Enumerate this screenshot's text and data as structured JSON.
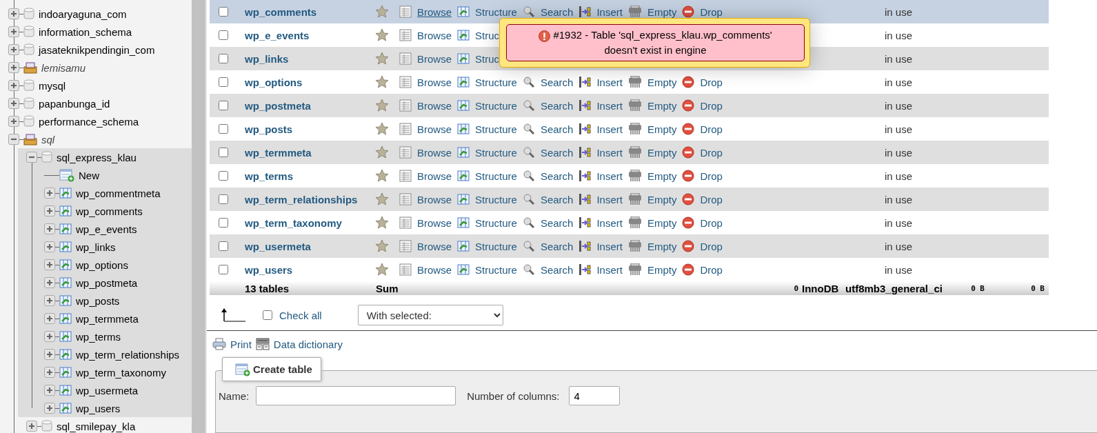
{
  "sidebar": {
    "tree": [
      {
        "name": "indoaryaguna_com",
        "kind": "db",
        "expanded": false,
        "selected": false
      },
      {
        "name": "information_schema",
        "kind": "db",
        "expanded": false,
        "selected": false
      },
      {
        "name": "jasateknikpendingin_com",
        "kind": "db",
        "expanded": false,
        "selected": false
      },
      {
        "name": "lemisamu",
        "kind": "group",
        "expanded": false,
        "selected": false
      },
      {
        "name": "mysql",
        "kind": "db",
        "expanded": false,
        "selected": false
      },
      {
        "name": "papanbunga_id",
        "kind": "db",
        "expanded": false,
        "selected": false
      },
      {
        "name": "performance_schema",
        "kind": "db",
        "expanded": false,
        "selected": false
      },
      {
        "name": "sql",
        "kind": "group",
        "expanded": true,
        "selected": false,
        "children": [
          {
            "name": "sql_express_klau",
            "kind": "db",
            "expanded": true,
            "selected": true,
            "children": [
              {
                "name": "New",
                "kind": "new"
              },
              {
                "name": "wp_commentmeta",
                "kind": "table",
                "expanded": false
              },
              {
                "name": "wp_comments",
                "kind": "table",
                "expanded": false
              },
              {
                "name": "wp_e_events",
                "kind": "table",
                "expanded": false
              },
              {
                "name": "wp_links",
                "kind": "table",
                "expanded": false
              },
              {
                "name": "wp_options",
                "kind": "table",
                "expanded": false
              },
              {
                "name": "wp_postmeta",
                "kind": "table",
                "expanded": false
              },
              {
                "name": "wp_posts",
                "kind": "table",
                "expanded": false
              },
              {
                "name": "wp_termmeta",
                "kind": "table",
                "expanded": false
              },
              {
                "name": "wp_terms",
                "kind": "table",
                "expanded": false
              },
              {
                "name": "wp_term_relationships",
                "kind": "table",
                "expanded": false
              },
              {
                "name": "wp_term_taxonomy",
                "kind": "table",
                "expanded": false
              },
              {
                "name": "wp_usermeta",
                "kind": "table",
                "expanded": false
              },
              {
                "name": "wp_users",
                "kind": "table",
                "expanded": false
              }
            ]
          },
          {
            "name": "sql_smilepay_kla",
            "kind": "db",
            "expanded": false,
            "selected": false
          }
        ]
      }
    ]
  },
  "table": {
    "rows": [
      {
        "name": "wp_comments",
        "checked": false,
        "highlighted": true,
        "status": "in use",
        "actions": [
          {
            "kind": "browse",
            "label": "Browse"
          },
          {
            "kind": "structure",
            "label": "Structure"
          },
          {
            "kind": "search",
            "label": "Search"
          },
          {
            "kind": "insert",
            "label": "Insert"
          },
          {
            "kind": "empty",
            "label": "Empty"
          },
          {
            "kind": "drop",
            "label": "Drop"
          }
        ]
      },
      {
        "name": "wp_e_events",
        "checked": false,
        "highlighted": false,
        "status": "in use",
        "actions": [
          {
            "kind": "browse",
            "label": "Browse"
          },
          {
            "kind": "structure",
            "label": "Struc"
          }
        ]
      },
      {
        "name": "wp_links",
        "checked": false,
        "highlighted": false,
        "status": "in use",
        "actions": [
          {
            "kind": "browse",
            "label": "Browse"
          },
          {
            "kind": "structure",
            "label": "Struc"
          }
        ]
      },
      {
        "name": "wp_options",
        "checked": false,
        "highlighted": false,
        "status": "in use",
        "actions": [
          {
            "kind": "browse",
            "label": "Browse"
          },
          {
            "kind": "structure",
            "label": "Structure"
          },
          {
            "kind": "search",
            "label": "Search"
          },
          {
            "kind": "insert",
            "label": "Insert"
          },
          {
            "kind": "empty",
            "label": "Empty"
          },
          {
            "kind": "drop",
            "label": "Drop"
          }
        ]
      },
      {
        "name": "wp_postmeta",
        "checked": false,
        "highlighted": false,
        "status": "in use",
        "actions": [
          {
            "kind": "browse",
            "label": "Browse"
          },
          {
            "kind": "structure",
            "label": "Structure"
          },
          {
            "kind": "search",
            "label": "Search"
          },
          {
            "kind": "insert",
            "label": "Insert"
          },
          {
            "kind": "empty",
            "label": "Empty"
          },
          {
            "kind": "drop",
            "label": "Drop"
          }
        ]
      },
      {
        "name": "wp_posts",
        "checked": false,
        "highlighted": false,
        "status": "in use",
        "actions": [
          {
            "kind": "browse",
            "label": "Browse"
          },
          {
            "kind": "structure",
            "label": "Structure"
          },
          {
            "kind": "search",
            "label": "Search"
          },
          {
            "kind": "insert",
            "label": "Insert"
          },
          {
            "kind": "empty",
            "label": "Empty"
          },
          {
            "kind": "drop",
            "label": "Drop"
          }
        ]
      },
      {
        "name": "wp_termmeta",
        "checked": false,
        "highlighted": false,
        "status": "in use",
        "actions": [
          {
            "kind": "browse",
            "label": "Browse"
          },
          {
            "kind": "structure",
            "label": "Structure"
          },
          {
            "kind": "search",
            "label": "Search"
          },
          {
            "kind": "insert",
            "label": "Insert"
          },
          {
            "kind": "empty",
            "label": "Empty"
          },
          {
            "kind": "drop",
            "label": "Drop"
          }
        ]
      },
      {
        "name": "wp_terms",
        "checked": false,
        "highlighted": false,
        "status": "in use",
        "actions": [
          {
            "kind": "browse",
            "label": "Browse"
          },
          {
            "kind": "structure",
            "label": "Structure"
          },
          {
            "kind": "search",
            "label": "Search"
          },
          {
            "kind": "insert",
            "label": "Insert"
          },
          {
            "kind": "empty",
            "label": "Empty"
          },
          {
            "kind": "drop",
            "label": "Drop"
          }
        ]
      },
      {
        "name": "wp_term_relationships",
        "checked": false,
        "highlighted": false,
        "status": "in use",
        "actions": [
          {
            "kind": "browse",
            "label": "Browse"
          },
          {
            "kind": "structure",
            "label": "Structure"
          },
          {
            "kind": "search",
            "label": "Search"
          },
          {
            "kind": "insert",
            "label": "Insert"
          },
          {
            "kind": "empty",
            "label": "Empty"
          },
          {
            "kind": "drop",
            "label": "Drop"
          }
        ]
      },
      {
        "name": "wp_term_taxonomy",
        "checked": false,
        "highlighted": false,
        "status": "in use",
        "actions": [
          {
            "kind": "browse",
            "label": "Browse"
          },
          {
            "kind": "structure",
            "label": "Structure"
          },
          {
            "kind": "search",
            "label": "Search"
          },
          {
            "kind": "insert",
            "label": "Insert"
          },
          {
            "kind": "empty",
            "label": "Empty"
          },
          {
            "kind": "drop",
            "label": "Drop"
          }
        ]
      },
      {
        "name": "wp_usermeta",
        "checked": false,
        "highlighted": false,
        "status": "in use",
        "actions": [
          {
            "kind": "browse",
            "label": "Browse"
          },
          {
            "kind": "structure",
            "label": "Structure"
          },
          {
            "kind": "search",
            "label": "Search"
          },
          {
            "kind": "insert",
            "label": "Insert"
          },
          {
            "kind": "empty",
            "label": "Empty"
          },
          {
            "kind": "drop",
            "label": "Drop"
          }
        ]
      },
      {
        "name": "wp_users",
        "checked": false,
        "highlighted": false,
        "status": "in use",
        "actions": [
          {
            "kind": "browse",
            "label": "Browse"
          },
          {
            "kind": "structure",
            "label": "Structure"
          },
          {
            "kind": "search",
            "label": "Search"
          },
          {
            "kind": "insert",
            "label": "Insert"
          },
          {
            "kind": "empty",
            "label": "Empty"
          },
          {
            "kind": "drop",
            "label": "Drop"
          }
        ]
      }
    ],
    "summary": {
      "count": "13 tables",
      "label": "Sum",
      "rows": "0",
      "engine": "InnoDB",
      "collation": "utf8mb3_general_ci",
      "size": "0 B",
      "overhead": "0 B"
    }
  },
  "bulk": {
    "check_all": {
      "label": "Check all",
      "checked": false
    },
    "with_selected": "With selected:"
  },
  "links": [
    {
      "kind": "print",
      "label": "Print"
    },
    {
      "kind": "dictionary",
      "label": "Data dictionary"
    }
  ],
  "create_table": {
    "title": "Create table",
    "fields": [
      {
        "label": "Name:"
      },
      {
        "label": "Number of columns:",
        "value": "4"
      }
    ]
  },
  "error": {
    "message": "#1932 - Table 'sql_express_klau.wp_comments' doesn't exist in engine"
  }
}
